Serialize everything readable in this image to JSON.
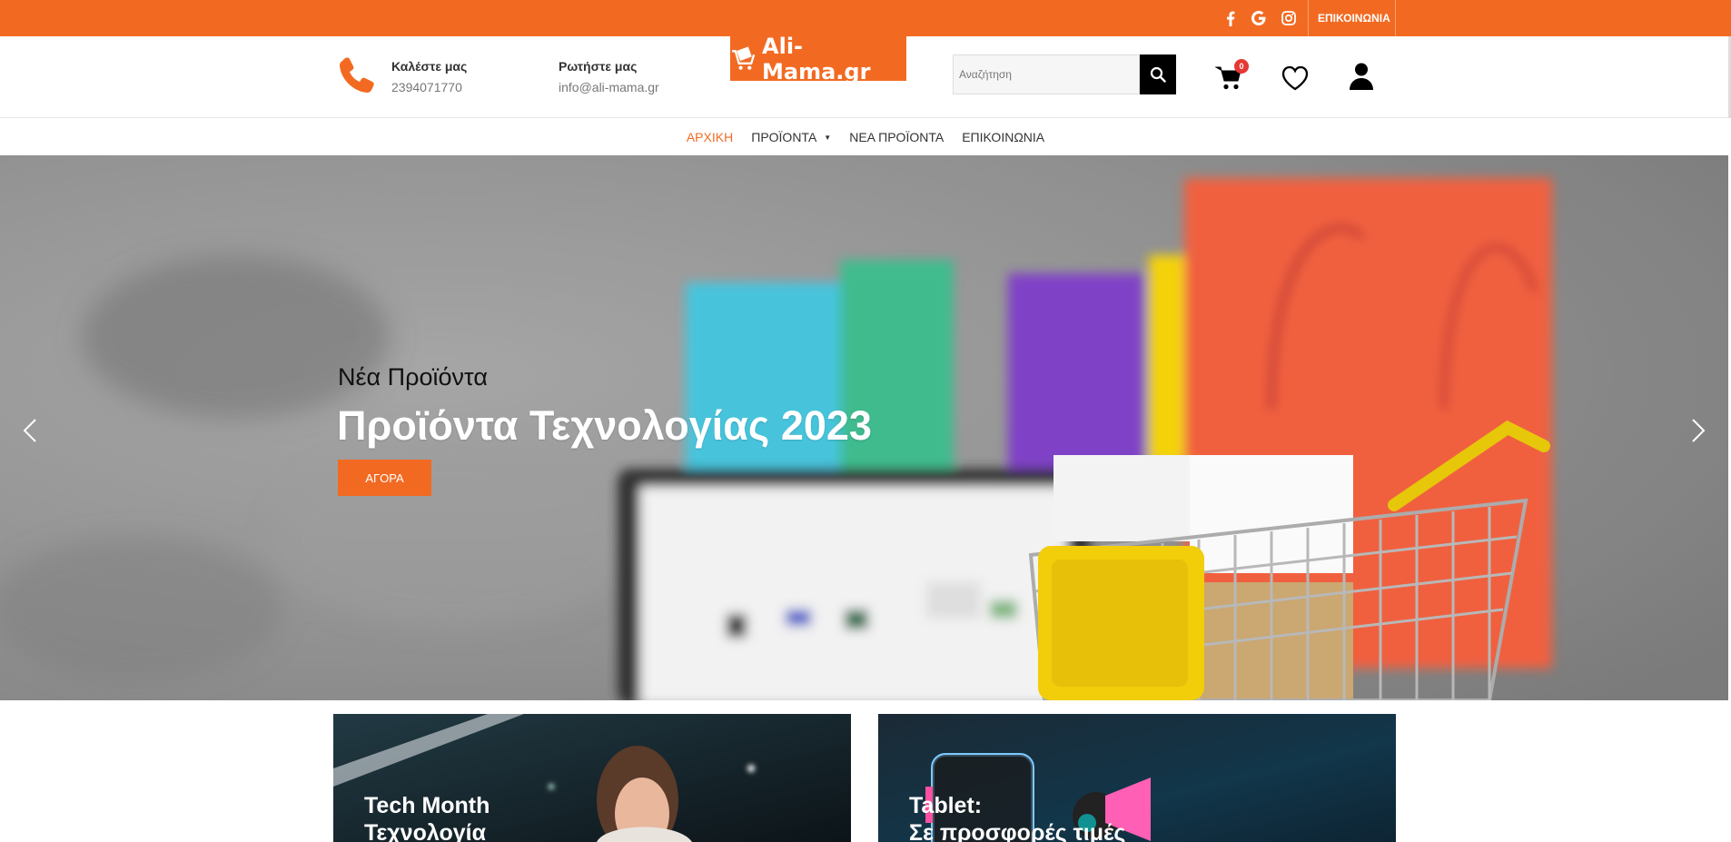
{
  "topbar": {
    "social": [
      "facebook-icon",
      "google-icon",
      "instagram-icon"
    ],
    "contact_link": "ΕΠΙΚΟΙΝΩΝΙΑ"
  },
  "header": {
    "call": {
      "title": "Καλέστε μας",
      "value": "2394071770"
    },
    "ask": {
      "title": "Ρωτήστε μας",
      "value": "info@ali-mama.gr"
    },
    "logo_text": "Ali-Mama.gr",
    "search_placeholder": "Αναζήτηση",
    "cart_count": "0"
  },
  "nav": {
    "items": [
      {
        "label": "ΑΡΧΙΚΗ",
        "active": true
      },
      {
        "label": "ΠΡΟΪΟΝΤΑ",
        "dropdown": true
      },
      {
        "label": "ΝΕΑ ΠΡΟΪΟΝΤΑ"
      },
      {
        "label": "ΕΠΙΚΟΙΝΩΝΙΑ"
      }
    ]
  },
  "hero": {
    "subtitle": "Νέα Προϊόντα",
    "title": "Προϊόντα Τεχνολογίας 2023",
    "button": "ΑΓΟΡΑ"
  },
  "cards": [
    {
      "title_line1": "Tech Month",
      "title_line2": "Τεχνολογία"
    },
    {
      "title_line1": "Tablet:",
      "title_line2": "Σε προσφορές τιμές"
    }
  ],
  "colors": {
    "accent": "#f26a22",
    "black": "#000000"
  }
}
